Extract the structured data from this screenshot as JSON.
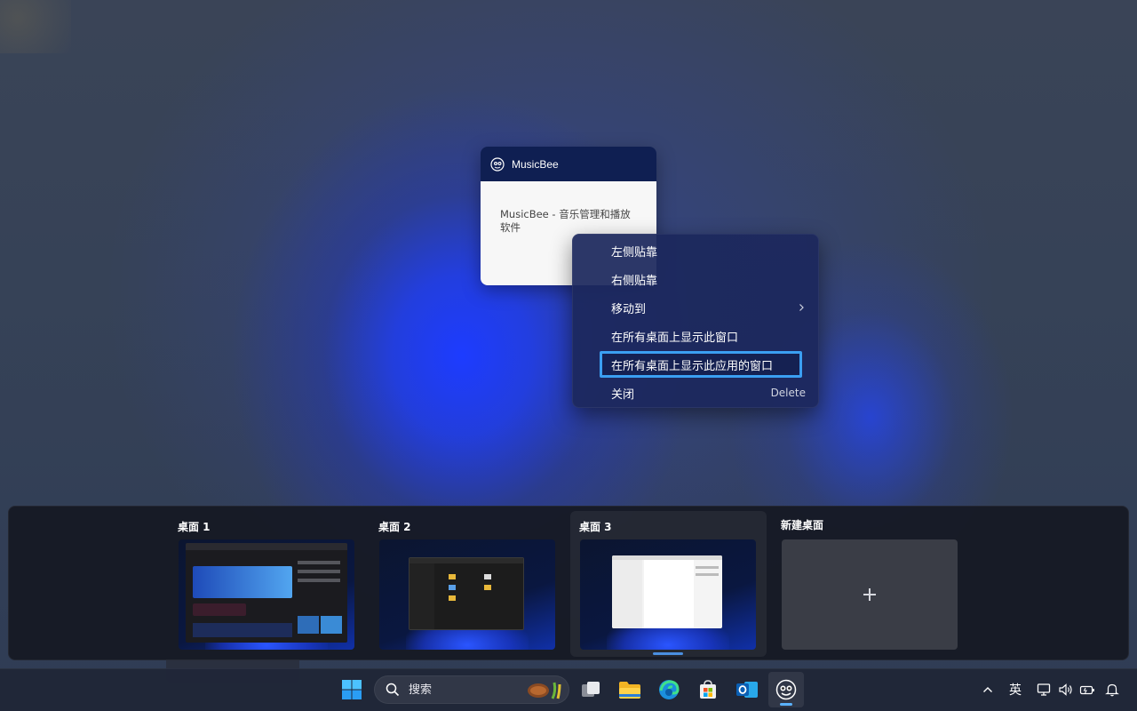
{
  "window_thumbnail": {
    "app_name": "MusicBee",
    "description": "MusicBee - 音乐管理和播放软件"
  },
  "context_menu": {
    "items": [
      {
        "label": "左侧贴靠"
      },
      {
        "label": "右侧贴靠"
      },
      {
        "label": "移动到"
      },
      {
        "label": "在所有桌面上显示此窗口"
      },
      {
        "label": "在所有桌面上显示此应用的窗口"
      },
      {
        "label": "关闭",
        "shortcut": "Delete"
      }
    ],
    "focus_color": "#3b9ff2"
  },
  "desktops": {
    "items": [
      {
        "label": "桌面 1"
      },
      {
        "label": "桌面 2"
      },
      {
        "label": "桌面 3"
      }
    ],
    "new_desktop_label": "新建桌面",
    "active_index": 3
  },
  "taskbar": {
    "search_placeholder": "搜索",
    "apps": [
      "windows-start-icon",
      "task-view-icon",
      "file-explorer-icon",
      "edge-icon",
      "store-icon",
      "outlook-icon",
      "musicbee-icon"
    ],
    "accent_color": "#5ab2ff"
  },
  "tray": {
    "ime_label": "英",
    "icons": [
      "chevron-up-icon",
      "display-icon",
      "volume-icon",
      "battery-icon",
      "bell-icon"
    ]
  }
}
